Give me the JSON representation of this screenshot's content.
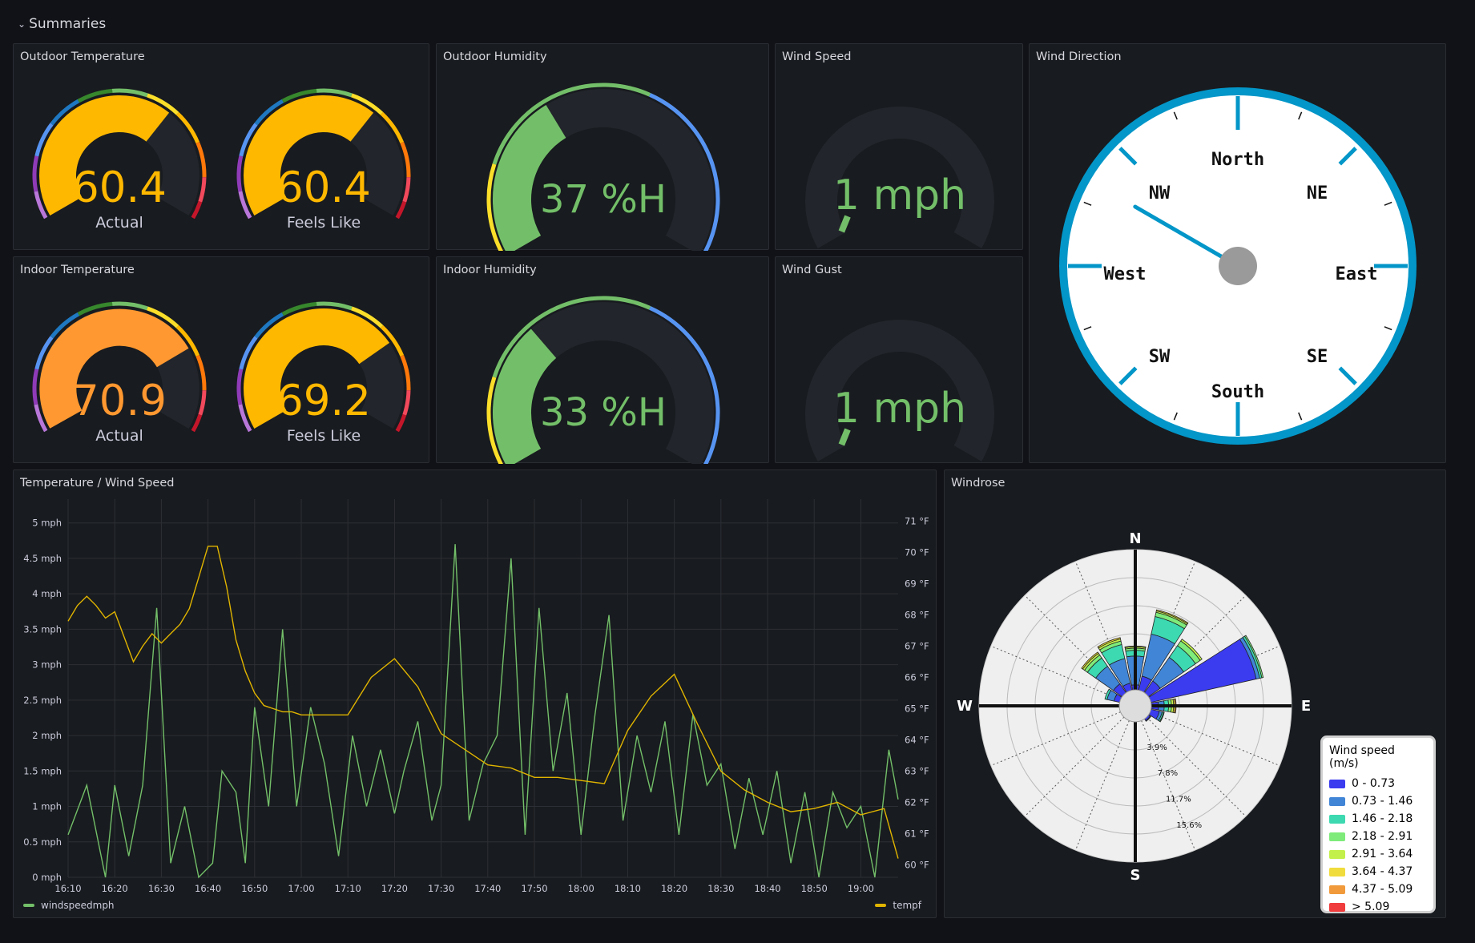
{
  "row": {
    "title": "Summaries",
    "chevron": "chevron-down-icon"
  },
  "outdoor_temp": {
    "title": "Outdoor Temperature",
    "actual": {
      "value": "60.4",
      "label": "Actual",
      "fraction": 0.66,
      "color": "#FFB800"
    },
    "feels": {
      "value": "60.4",
      "label": "Feels Like",
      "fraction": 0.66,
      "color": "#FFB800"
    }
  },
  "indoor_temp": {
    "title": "Indoor Temperature",
    "actual": {
      "value": "70.9",
      "label": "Actual",
      "fraction": 0.75,
      "color": "#FF9830"
    },
    "feels": {
      "value": "69.2",
      "label": "Feels Like",
      "fraction": 0.73,
      "color": "#FFB800"
    }
  },
  "outdoor_humidity": {
    "title": "Outdoor Humidity",
    "value": "37 %H",
    "fraction": 0.37,
    "color": "#73BF69"
  },
  "indoor_humidity": {
    "title": "Indoor Humidity",
    "value": "33 %H",
    "fraction": 0.33,
    "color": "#73BF69"
  },
  "wind_speed": {
    "title": "Wind Speed",
    "value": "1 mph",
    "fraction": 0.04,
    "color": "#73BF69"
  },
  "wind_gust": {
    "title": "Wind Gust",
    "value": "1 mph",
    "fraction": 0.04,
    "color": "#73BF69"
  },
  "wind_direction": {
    "title": "Wind Direction",
    "labels": {
      "north": "North",
      "ne": "NE",
      "east": "East",
      "se": "SE",
      "south": "South",
      "sw": "SW",
      "west": "West",
      "nw": "NW"
    },
    "needle_deg": 300,
    "ring_color": "#0396C8"
  },
  "temp_wind": {
    "title": "Temperature / Wind Speed",
    "legend": {
      "left": "windspeedmph",
      "right": "tempf"
    },
    "colors": {
      "wind": "#73BF69",
      "temp": "#E0B400"
    }
  },
  "chart_data": {
    "type": "line",
    "x_ticks": [
      "16:10",
      "16:20",
      "16:30",
      "16:40",
      "16:50",
      "17:00",
      "17:10",
      "17:20",
      "17:30",
      "17:40",
      "17:50",
      "18:00",
      "18:10",
      "18:20",
      "18:30",
      "18:40",
      "18:50",
      "19:00"
    ],
    "y_left_ticks": [
      "0 mph",
      "0.5 mph",
      "1 mph",
      "1.5 mph",
      "2 mph",
      "2.5 mph",
      "3 mph",
      "3.5 mph",
      "4 mph",
      "4.5 mph",
      "5 mph"
    ],
    "y_right_ticks": [
      "60 °F",
      "61 °F",
      "62 °F",
      "63 °F",
      "64 °F",
      "65 °F",
      "66 °F",
      "67 °F",
      "68 °F",
      "69 °F",
      "70 °F",
      "71 °F"
    ],
    "ylim_left": [
      0,
      5.2
    ],
    "ylim_right": [
      59.6,
      71.4
    ],
    "xlim_min": [
      0,
      178
    ],
    "series": [
      {
        "name": "windspeedmph",
        "axis": "left",
        "x": [
          0,
          4,
          8,
          10,
          13,
          16,
          19,
          22,
          25,
          28,
          31,
          33,
          36,
          38,
          40,
          43,
          46,
          49,
          52,
          55,
          58,
          61,
          64,
          67,
          70,
          72,
          75,
          78,
          80,
          83,
          86,
          89,
          92,
          95,
          98,
          101,
          104,
          107,
          110,
          113,
          116,
          119,
          122,
          125,
          128,
          131,
          134,
          137,
          140,
          143,
          146,
          149,
          152,
          155,
          158,
          161,
          164,
          167,
          170,
          173,
          176,
          178
        ],
        "y": [
          0.6,
          1.3,
          0,
          1.3,
          0.3,
          1.3,
          3.8,
          0.2,
          1.0,
          0,
          0.2,
          1.5,
          1.2,
          0.2,
          2.4,
          1.0,
          3.5,
          1.0,
          2.4,
          1.6,
          0.3,
          2.0,
          1.0,
          1.8,
          0.9,
          1.5,
          2.2,
          0.8,
          1.3,
          4.7,
          0.8,
          1.6,
          2.0,
          4.5,
          0.6,
          3.8,
          1.5,
          2.6,
          0.6,
          2.3,
          3.7,
          0.8,
          2.0,
          1.2,
          2.2,
          0.6,
          2.3,
          1.3,
          1.6,
          0.4,
          1.4,
          0.6,
          1.5,
          0.2,
          1.2,
          0.0,
          1.2,
          0.7,
          1.0,
          0.0,
          1.8,
          1.1
        ]
      },
      {
        "name": "tempf",
        "axis": "right",
        "x": [
          0,
          2,
          4,
          6,
          8,
          10,
          12,
          14,
          16,
          18,
          20,
          22,
          24,
          26,
          28,
          30,
          32,
          34,
          36,
          38,
          40,
          42,
          44,
          46,
          48,
          50,
          55,
          60,
          65,
          70,
          75,
          80,
          85,
          90,
          95,
          100,
          105,
          110,
          115,
          120,
          125,
          130,
          135,
          140,
          145,
          150,
          155,
          160,
          165,
          170,
          175,
          178
        ],
        "y": [
          67.8,
          68.3,
          68.6,
          68.3,
          67.9,
          68.1,
          67.3,
          66.5,
          67.0,
          67.4,
          67.1,
          67.4,
          67.7,
          68.2,
          69.2,
          70.2,
          70.2,
          68.9,
          67.2,
          66.2,
          65.5,
          65.1,
          65.0,
          64.9,
          64.9,
          64.8,
          64.8,
          64.8,
          66.0,
          66.6,
          65.7,
          64.2,
          63.7,
          63.2,
          63.1,
          62.8,
          62.8,
          62.7,
          62.6,
          64.3,
          65.4,
          66.1,
          64.5,
          63.0,
          62.4,
          62.0,
          61.7,
          61.8,
          62.0,
          61.6,
          61.8,
          60.2
        ]
      }
    ]
  },
  "windrose": {
    "title": "Windrose",
    "compass": {
      "n": "N",
      "e": "E",
      "s": "S",
      "w": "W"
    },
    "rings": [
      "3.9%",
      "7.8%",
      "11.7%",
      "15.6%"
    ],
    "legend_title": "Wind speed (m/s)",
    "bins": [
      {
        "label": "0 - 0.73",
        "color": "#3B3BF0"
      },
      {
        "label": "0.73 - 1.46",
        "color": "#4185D6"
      },
      {
        "label": "1.46 - 2.18",
        "color": "#3DD9B0"
      },
      {
        "label": "2.18 - 2.91",
        "color": "#7EEB7A"
      },
      {
        "label": "2.91 - 3.64",
        "color": "#C3F04A"
      },
      {
        "label": "3.64 - 4.37",
        "color": "#F0DC3C"
      },
      {
        "label": "4.37 - 5.09",
        "color": "#F09A3C"
      },
      {
        "label": "> 5.09",
        "color": "#F03C3C"
      }
    ],
    "petals": [
      {
        "dir": 0,
        "stack": [
          0.7,
          4.0,
          0.8,
          0.3,
          0.2,
          0.1
        ]
      },
      {
        "dir": 22.5,
        "stack": [
          2.0,
          6.0,
          2.5,
          0.6,
          0.2,
          0.15
        ]
      },
      {
        "dir": 45,
        "stack": [
          2.0,
          4.0,
          2.0,
          0.8,
          0.3
        ]
      },
      {
        "dir": 67.5,
        "stack": [
          15.0,
          0.5,
          0.3,
          0.2
        ]
      },
      {
        "dir": 90,
        "stack": [
          1.0,
          0.8,
          0.6,
          0.4,
          0.3,
          0.2,
          0.15
        ]
      },
      {
        "dir": 112.5,
        "stack": [
          1.2,
          0.4,
          0.2,
          0.1
        ]
      },
      {
        "dir": 135,
        "stack": [
          0.3,
          0.1
        ]
      },
      {
        "dir": 292.5,
        "stack": [
          0.8,
          1.0,
          0.3
        ]
      },
      {
        "dir": 315,
        "stack": [
          1.5,
          3.0,
          1.4,
          0.5,
          0.3,
          0.2
        ]
      },
      {
        "dir": 337.5,
        "stack": [
          1.0,
          3.5,
          2.0,
          0.5,
          0.3,
          0.2
        ]
      }
    ],
    "ring_max": 19.5
  }
}
